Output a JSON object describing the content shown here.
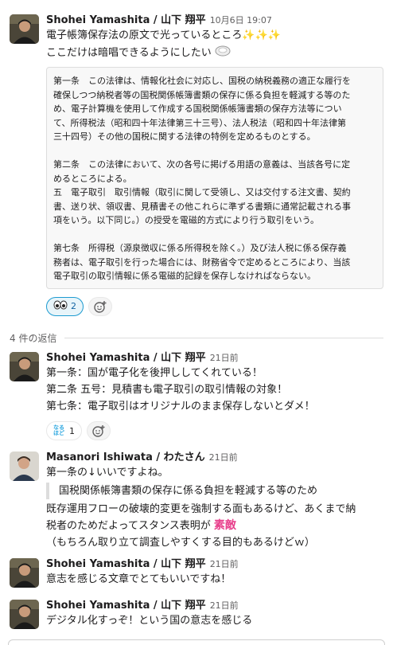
{
  "thread": {
    "parent": {
      "author": "Shohei Yamashita / 山下 翔平",
      "time": "10月6日 19:07",
      "lines": [
        "電子帳簿保存法の原文で光っているところ",
        "ここだけは暗唱できるようにしたい"
      ],
      "quote": [
        "第一条　この法律は、情報化社会に対応し、国税の納税義務の適正な履行を",
        "確保しつつ納税者等の国税関係帳簿書類の保存に係る負担を軽減する等のた",
        "め、電子計算機を使用して作成する国税関係帳簿書類の保存方法等につい",
        "て、所得税法（昭和四十年法律第三十三号）、法人税法（昭和四十年法律第",
        "三十四号）その他の国税に関する法律の特例を定めるものとする。",
        "",
        "第二条　この法律において、次の各号に掲げる用語の意義は、当該各号に定",
        "めるところによる。",
        "五　電子取引　取引情報（取引に関して受領し、又は交付する注文書、契約",
        "書、送り状、領収書、見積書その他これらに準ずる書類に通常記載される事",
        "項をいう。以下同じ。）の授受を電磁的方式により行う取引をいう。",
        "",
        "第七条　所得税（源泉徴収に係る所得税を除く。）及び法人税に係る保存義",
        "務者は、電子取引を行った場合には、財務省令で定めるところにより、当該",
        "電子取引の取引情報に係る電磁的記録を保存しなければならない。"
      ],
      "reactions": [
        {
          "icon": "eyes-emoji",
          "count": "2",
          "active": true
        }
      ]
    },
    "reply_count_label": "4 件の返信",
    "replies": [
      {
        "author": "Shohei Yamashita / 山下 翔平",
        "time": "21日前",
        "lines": [
          "第一条：国が電子化を後押ししてくれている！",
          "第二条 五号：見積書も電子取引の取引情報の対象！",
          "第七条：電子取引はオリジナルのまま保存しないとダメ！"
        ],
        "reaction": {
          "icon": "naruhodo-emoji",
          "label": "なるほど",
          "count": "1"
        }
      },
      {
        "author": "Masanori Ishiwata / わたさん",
        "time": "21日前",
        "line1": "第一条の↓いいですよね。",
        "quote": "国税関係帳簿書類の保存に係る負担を軽減する等のため",
        "line2": "既存運用フローの破壊的変更を強制する面もあるけど、あくまで納",
        "line3": "税者のためだよってスタンス表明が",
        "emoji_text": "素敵",
        "line4": "（もちろん取り立て調査しやすくする目的もあるけどｗ）"
      },
      {
        "author": "Shohei Yamashita / 山下 翔平",
        "time": "21日前",
        "line": "意志を感じる文章でとてもいいですね！"
      },
      {
        "author": "Shohei Yamashita / 山下 翔平",
        "time": "21日前",
        "line": "デジタル化すっぞ！という国の意志を感じる"
      }
    ]
  },
  "colors": {
    "link_blue": "#1264a3",
    "reaction_border": "#1d9bd1",
    "muted": "#616061",
    "quote_bg": "#f8f8f8"
  }
}
